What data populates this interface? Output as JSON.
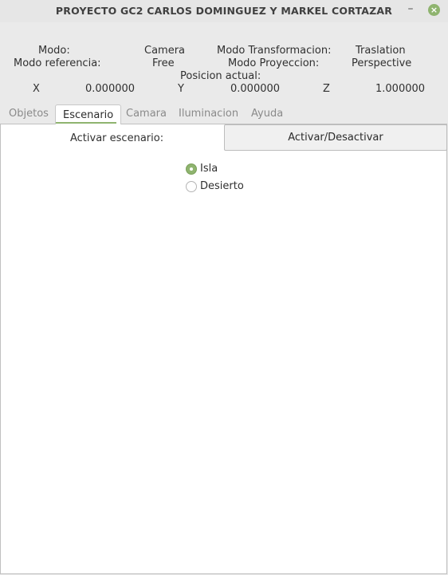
{
  "window": {
    "title": "PROYECTO GC2 CARLOS DOMINGUEZ Y MARKEL CORTAZAR",
    "minimize_glyph": "–",
    "close_glyph": "×"
  },
  "info": {
    "modo_label": "Modo:",
    "modo_value": "Camera",
    "transform_label": "Modo Transformacion:",
    "transform_value": "Traslation",
    "referencia_label": "Modo referencia:",
    "referencia_value": "Free",
    "proyeccion_label": "Modo Proyeccion:",
    "proyeccion_value": "Perspective",
    "posicion_label": "Posicion actual:",
    "x_label": "X",
    "x_value": "0.000000",
    "y_label": "Y",
    "y_value": "0.000000",
    "z_label": "Z",
    "z_value": "1.000000"
  },
  "tabs": [
    {
      "label": "Objetos"
    },
    {
      "label": "Escenario"
    },
    {
      "label": "Camara"
    },
    {
      "label": "Iluminacion"
    },
    {
      "label": "Ayuda"
    }
  ],
  "escenario": {
    "activar_label": "Activar escenario:",
    "toggle_button": "Activar/Desactivar",
    "options": [
      {
        "label": "Isla",
        "selected": true
      },
      {
        "label": "Desierto",
        "selected": false
      }
    ]
  },
  "colors": {
    "accent": "#8fb46f",
    "background": "#eaeaea",
    "panel": "#ffffff"
  }
}
